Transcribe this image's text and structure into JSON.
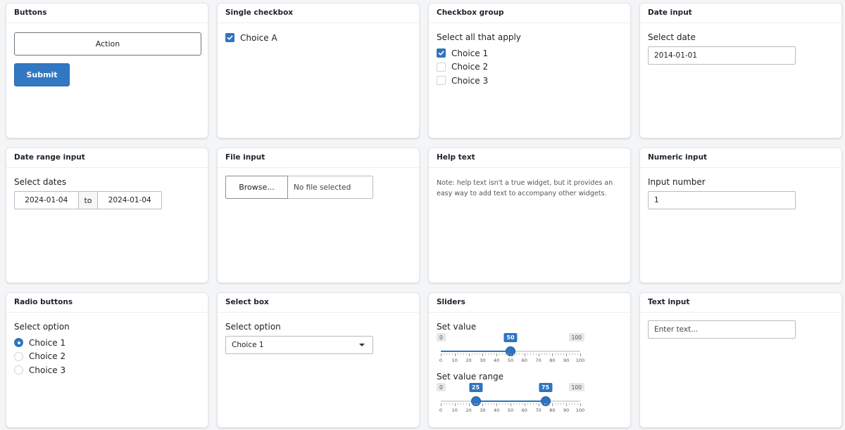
{
  "buttons": {
    "title": "Buttons",
    "action_label": "Action",
    "submit_label": "Submit"
  },
  "single_checkbox": {
    "title": "Single checkbox",
    "label": "Choice A",
    "checked": true
  },
  "checkbox_group": {
    "title": "Checkbox group",
    "label": "Select all that apply",
    "options": [
      {
        "label": "Choice 1",
        "checked": true
      },
      {
        "label": "Choice 2",
        "checked": false
      },
      {
        "label": "Choice 3",
        "checked": false
      }
    ]
  },
  "date_input": {
    "title": "Date input",
    "label": "Select date",
    "value": "2014-01-01"
  },
  "date_range": {
    "title": "Date range input",
    "label": "Select dates",
    "start": "2024-01-04",
    "separator": "to",
    "end": "2024-01-04"
  },
  "file_input": {
    "title": "File input",
    "browse_label": "Browse...",
    "status": "No file selected"
  },
  "help_text": {
    "title": "Help text",
    "text": "Note: help text isn't a true widget, but it provides an easy way to add text to accompany other widgets."
  },
  "numeric_input": {
    "title": "Numeric input",
    "label": "Input number",
    "value": "1"
  },
  "radio_buttons": {
    "title": "Radio buttons",
    "label": "Select option",
    "options": [
      {
        "label": "Choice 1",
        "checked": true
      },
      {
        "label": "Choice 2",
        "checked": false
      },
      {
        "label": "Choice 3",
        "checked": false
      }
    ]
  },
  "select_box": {
    "title": "Select box",
    "label": "Select option",
    "value": "Choice 1"
  },
  "sliders": {
    "title": "Sliders",
    "single": {
      "label": "Set value",
      "min": 0,
      "max": 100,
      "value": 50,
      "min_label": "0",
      "max_label": "100",
      "value_label": "50"
    },
    "range": {
      "label": "Set value range",
      "min": 0,
      "max": 100,
      "low": 25,
      "high": 75,
      "min_label": "0",
      "max_label": "100",
      "low_label": "25",
      "high_label": "75"
    },
    "tick_labels": [
      "0",
      "10",
      "20",
      "30",
      "40",
      "50",
      "60",
      "70",
      "80",
      "90",
      "100"
    ]
  },
  "text_input": {
    "title": "Text input",
    "placeholder": "Enter text..."
  },
  "colors": {
    "accent": "#2f74c0",
    "background": "#f4f5f7"
  }
}
